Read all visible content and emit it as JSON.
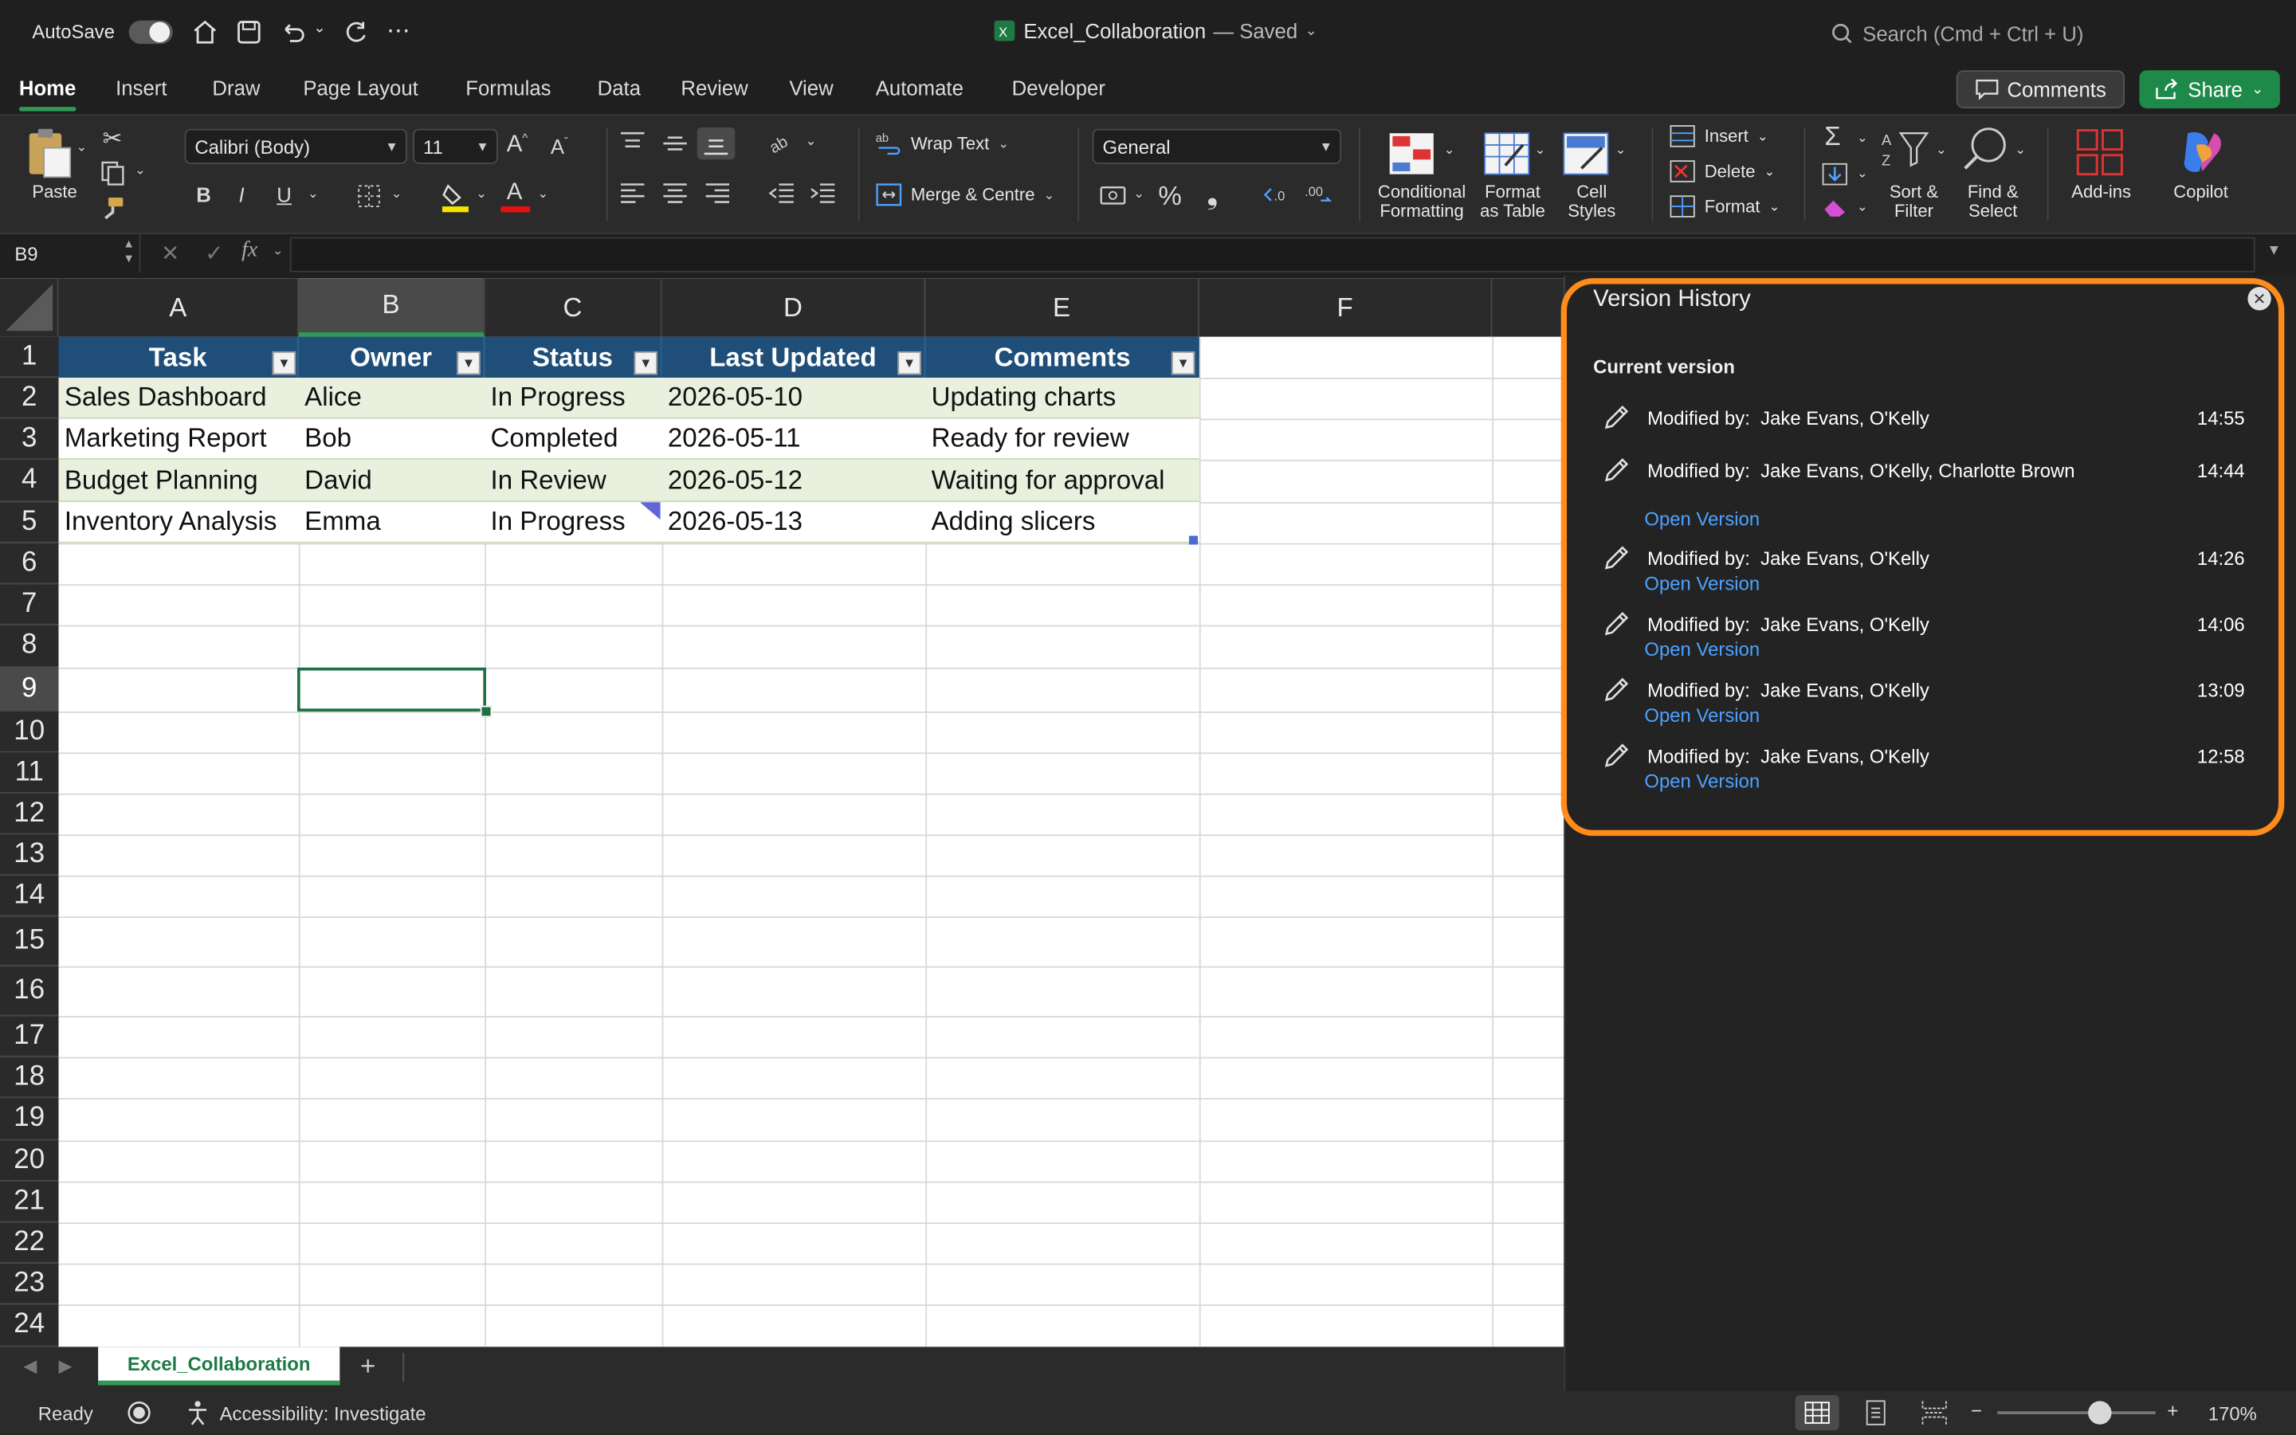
{
  "titlebar": {
    "autosave_label": "AutoSave",
    "file_title": "Excel_Collaboration",
    "save_state": "— Saved",
    "search_placeholder": "Search (Cmd + Ctrl + U)"
  },
  "tabs": [
    "Home",
    "Insert",
    "Draw",
    "Page Layout",
    "Formulas",
    "Data",
    "Review",
    "View",
    "Automate",
    "Developer"
  ],
  "active_tab": "Home",
  "actions": {
    "comments": "Comments",
    "share": "Share"
  },
  "ribbon": {
    "paste": "Paste",
    "font_name": "Calibri (Body)",
    "font_size": "11",
    "wrap_text": "Wrap Text",
    "merge_centre": "Merge & Centre",
    "number_format": "General",
    "conditional_formatting": [
      "Conditional",
      "Formatting"
    ],
    "format_as_table": [
      "Format",
      "as Table"
    ],
    "cell_styles": [
      "Cell",
      "Styles"
    ],
    "insert": "Insert",
    "delete": "Delete",
    "format": "Format",
    "sort_filter": [
      "Sort &",
      "Filter"
    ],
    "find_select": [
      "Find &",
      "Select"
    ],
    "add_ins": "Add-ins",
    "copilot": "Copilot",
    "percent": "%",
    "comma": "❟",
    "font_color_letter": "A"
  },
  "formula_bar": {
    "name_box": "B9",
    "fx": "fx",
    "formula": ""
  },
  "sheet": {
    "columns": [
      "A",
      "B",
      "C",
      "D",
      "E",
      "F"
    ],
    "selected_column": "B",
    "rows": [
      "1",
      "2",
      "3",
      "4",
      "5",
      "6",
      "7",
      "8",
      "9",
      "10",
      "11",
      "12",
      "13",
      "14",
      "15",
      "16",
      "17",
      "18",
      "19",
      "20",
      "21",
      "22",
      "23",
      "24"
    ],
    "selected_row": "9",
    "headers": [
      "Task",
      "Owner",
      "Status",
      "Last Updated",
      "Comments"
    ],
    "data": [
      [
        "Sales Dashboard",
        "Alice",
        "In Progress",
        "2026-05-10",
        "Updating charts"
      ],
      [
        "Marketing Report",
        "Bob",
        "Completed",
        "2026-05-11",
        "Ready for review"
      ],
      [
        "Budget Planning",
        "David",
        "In Review",
        "2026-05-12",
        "Waiting for approval"
      ],
      [
        "Inventory Analysis",
        "Emma",
        "In Progress",
        "2026-05-13",
        "Adding slicers"
      ]
    ],
    "band_color": "#e9f0de",
    "header_color": "#1f4e79"
  },
  "sheet_tabs": {
    "name": "Excel_Collaboration",
    "add": "+"
  },
  "status_bar": {
    "ready": "Ready",
    "accessibility": "Accessibility: Investigate",
    "zoom": "170%",
    "zoom_minus": "−",
    "zoom_plus": "+",
    "zoom_level": 0.65
  },
  "version_history": {
    "title": "Version History",
    "current_label": "Current version",
    "entries": [
      {
        "modified_label": "Modified by:",
        "names": "Jake Evans, O'Kelly",
        "time": "14:55",
        "link": ""
      },
      {
        "modified_label": "Modified by:",
        "names": "Jake Evans, O'Kelly, Charlotte Brown",
        "time": "14:44",
        "link": "Open Version"
      },
      {
        "modified_label": "Modified by:",
        "names": "Jake Evans, O'Kelly",
        "time": "14:26",
        "link": "Open Version"
      },
      {
        "modified_label": "Modified by:",
        "names": "Jake Evans, O'Kelly",
        "time": "14:06",
        "link": "Open Version"
      },
      {
        "modified_label": "Modified by:",
        "names": "Jake Evans, O'Kelly",
        "time": "13:09",
        "link": "Open Version"
      },
      {
        "modified_label": "Modified by:",
        "names": "Jake Evans, O'Kelly",
        "time": "12:58",
        "link": "Open Version"
      }
    ],
    "highlight_color": "#ff8c1a",
    "link_color": "#4ea1ff"
  }
}
